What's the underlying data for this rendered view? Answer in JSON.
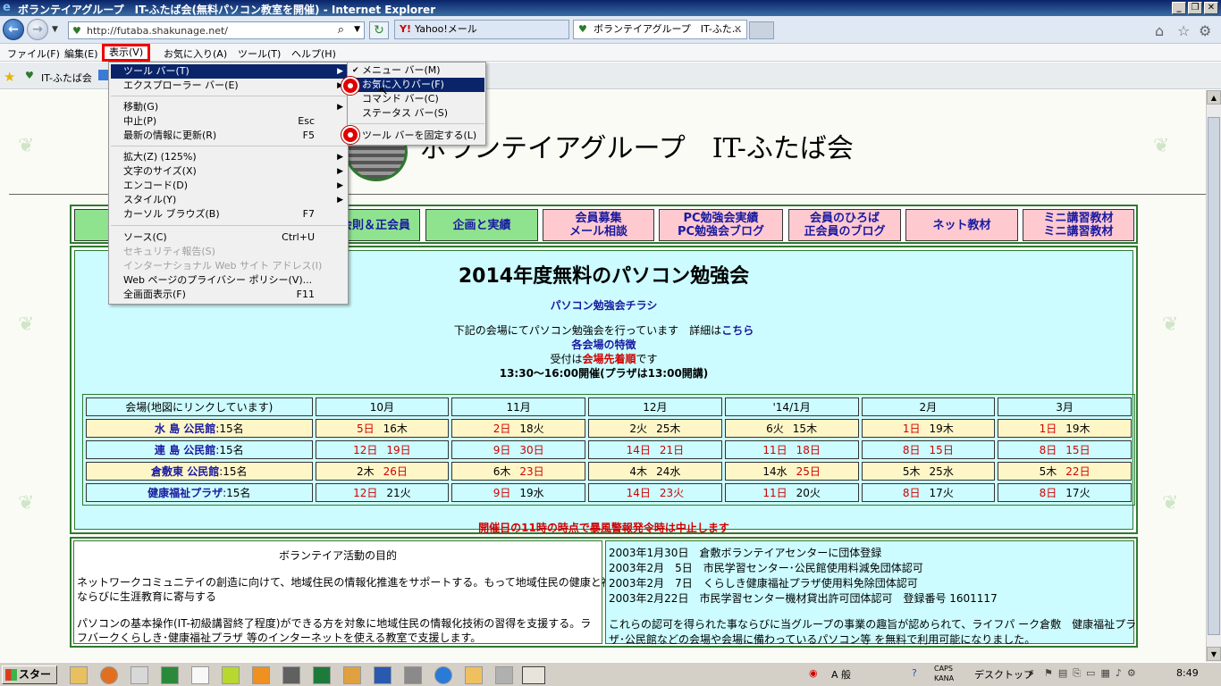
{
  "window": {
    "title": "ボランテイアグループ　IT-ふたば会(無料パソコン教室を開催) - Internet Explorer",
    "address": "http://futaba.shakunage.net/",
    "tabs": [
      {
        "label": "Yahoo!メール",
        "icon_text": "Y!"
      },
      {
        "label": "ボランテイアグループ　IT-ふた…",
        "icon_text": "♥"
      }
    ]
  },
  "menubar": {
    "items": [
      "ファイル(F)",
      "編集(E)",
      "表示(V)",
      "お気に入り(A)",
      "ツール(T)",
      "ヘルプ(H)"
    ]
  },
  "favorites_bar": {
    "item": "IT-ふたば会"
  },
  "view_menu": {
    "items": [
      {
        "label": "ツール バー(T)",
        "shortcut": ""
      },
      {
        "label": "エクスプローラー バー(E)",
        "shortcut": ""
      },
      {
        "label": "移動(G)",
        "shortcut": ""
      },
      {
        "label": "中止(P)",
        "shortcut": "Esc"
      },
      {
        "label": "最新の情報に更新(R)",
        "shortcut": "F5"
      },
      {
        "label": "拡大(Z) (125%)",
        "shortcut": ""
      },
      {
        "label": "文字のサイズ(X)",
        "shortcut": ""
      },
      {
        "label": "エンコード(D)",
        "shortcut": ""
      },
      {
        "label": "スタイル(Y)",
        "shortcut": ""
      },
      {
        "label": "カーソル ブラウズ(B)",
        "shortcut": "F7"
      },
      {
        "label": "ソース(C)",
        "shortcut": "Ctrl+U"
      },
      {
        "label": "セキュリティ報告(S)",
        "shortcut": ""
      },
      {
        "label": "インターナショナル Web サイト アドレス(I)",
        "shortcut": ""
      },
      {
        "label": "Web ページのプライバシー ポリシー(V)...",
        "shortcut": ""
      },
      {
        "label": "全画面表示(F)",
        "shortcut": "F11"
      }
    ]
  },
  "toolbar_submenu": {
    "items": [
      {
        "label": "メニュー バー(M)",
        "checked": true
      },
      {
        "label": "お気に入りバー(F)",
        "checked": true
      },
      {
        "label": "コマンド バー(C)",
        "checked": false
      },
      {
        "label": "ステータス バー(S)",
        "checked": false
      },
      {
        "label": "ツール バーを固定する(L)",
        "checked": true
      }
    ]
  },
  "site": {
    "title": "ボランテイアグループ　IT-ふたば会",
    "nav": [
      {
        "label": "",
        "color": "green"
      },
      {
        "label": "会則＆正会員",
        "color": "green"
      },
      {
        "label": "企画と実績",
        "color": "green"
      },
      {
        "label": "会員募集\nメール相談",
        "color": "pink"
      },
      {
        "label": "PC勉強会実績\nPC勉強会ブログ",
        "color": "pink"
      },
      {
        "label": "会員のひろば\n正会員のブログ",
        "color": "pink"
      },
      {
        "label": "ネット教材",
        "color": "pink"
      },
      {
        "label": "ミニ講習教材\nミニ講習教材",
        "color": "pink"
      }
    ],
    "heading": "2014年度無料のパソコン勉強会",
    "flyer_link": "パソコン勉強会チラシ",
    "intro_text": "下記の会場にてパソコン勉強会を行っています　詳細は",
    "intro_link": "こちら",
    "features_link": "各会場の特徴",
    "reception_prefix": "受付は",
    "reception_highlight": "会場先着順",
    "reception_suffix": "です",
    "hours": "13:30～16:00開催(プラザは13:00開講)",
    "schedule": {
      "header": [
        "会場(地図にリンクしています)",
        "10月",
        "11月",
        "12月",
        "'14/1月",
        "2月",
        "3月"
      ],
      "rows": [
        {
          "venue": "水 島 公民館",
          "cap": ":15名",
          "style": "yellow",
          "cells": [
            [
              "5日",
              "16木"
            ],
            [
              "2日",
              "18火"
            ],
            [
              "2火",
              "25木"
            ],
            [
              "6火",
              "15木"
            ],
            [
              "1日",
              "19木"
            ],
            [
              "1日",
              "19木"
            ]
          ],
          "red": [
            [
              true,
              false
            ],
            [
              true,
              false
            ],
            [
              false,
              false
            ],
            [
              false,
              false
            ],
            [
              true,
              false
            ],
            [
              true,
              false
            ]
          ]
        },
        {
          "venue": "連 島 公民館",
          "cap": ":15名",
          "style": "cyan",
          "cells": [
            [
              "12日",
              "19日"
            ],
            [
              "9日",
              "30日"
            ],
            [
              "14日",
              "21日"
            ],
            [
              "11日",
              "18日"
            ],
            [
              "8日",
              "15日"
            ],
            [
              "8日",
              "15日"
            ]
          ],
          "red": [
            [
              true,
              true
            ],
            [
              true,
              true
            ],
            [
              true,
              true
            ],
            [
              true,
              true
            ],
            [
              true,
              true
            ],
            [
              true,
              true
            ]
          ]
        },
        {
          "venue": "倉敷東 公民館",
          "cap": ":15名",
          "style": "yellow",
          "cells": [
            [
              "2木",
              "26日"
            ],
            [
              "6木",
              "23日"
            ],
            [
              "4木",
              "24水"
            ],
            [
              "14水",
              "25日"
            ],
            [
              "5木",
              "25水"
            ],
            [
              "5木",
              "22日"
            ]
          ],
          "red": [
            [
              false,
              true
            ],
            [
              false,
              true
            ],
            [
              false,
              false
            ],
            [
              false,
              true
            ],
            [
              false,
              false
            ],
            [
              false,
              true
            ]
          ]
        },
        {
          "venue": "健康福祉プラザ",
          "cap": ":15名",
          "style": "cyan",
          "cells": [
            [
              "12日",
              "21火"
            ],
            [
              "9日",
              "19水"
            ],
            [
              "14日",
              "23火"
            ],
            [
              "11日",
              "20火"
            ],
            [
              "8日",
              "17火"
            ],
            [
              "8日",
              "17火"
            ]
          ],
          "red": [
            [
              true,
              false
            ],
            [
              true,
              false
            ],
            [
              true,
              true
            ],
            [
              true,
              false
            ],
            [
              true,
              false
            ],
            [
              true,
              false
            ]
          ]
        }
      ]
    },
    "notice": "開催日の11時の時点で暴風警報発令時は中止します",
    "purpose_title": "ボランテイア活動の目的",
    "purpose_1a": "ネットワークコミュニテイの創造に向けて、地域住民の情報化推進をサポートする。もって地域住民の健康と福祉",
    "purpose_1b": "ならびに生涯教育に寄与する",
    "purpose_2a": "パソコンの基本操作(IT-初級講習終了程度)ができる方を対象に地域住民の情報化技術の習得を支援する。ラ",
    "purpose_2b": "フバークくらしき･健康福祉プラザ 等のインターネットを使える教室で支援します。",
    "history": [
      "2003年1月30日　倉敷ボランテイアセンターに団体登録",
      "2003年2月　5日　市民学習センター･公民館使用料減免団体認可",
      "2003年2月　7日　くらしき健康福祉プラザ使用料免除団体認可",
      "2003年2月22日　市民学習センター機材貸出許可団体認可　登録番号 1601117"
    ],
    "history_note_a": "これらの認可を得られた事ならびに当グループの事業の趣旨が認められて、ライフパ ーク倉敷　健康福祉プラ",
    "history_note_b": "ザ･公民館などの会場や会場に備わっているパソコン等 を無料で利用可能になりました。"
  },
  "taskbar": {
    "start": "スタート",
    "ime": "A 般",
    "caps": "CAPS",
    "kana": "KANA",
    "desktop": "デスクトップ",
    "clock": "8:49"
  }
}
